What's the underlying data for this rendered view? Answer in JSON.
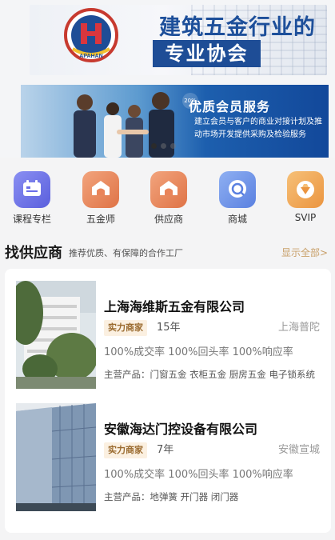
{
  "banner": {
    "top_line1": "建筑五金行业的",
    "top_line2": "专业协会",
    "logo_text": "APAHAN",
    "bottom_tag": "20%",
    "bottom_title": "优质会员服务",
    "bottom_sub": "建立会员与客户的商业对接计划及推动市场开发提供采购及检验服务"
  },
  "carousel": {
    "count": 3,
    "active": 0
  },
  "categories": [
    {
      "label": "课程专栏",
      "icon": "course-icon",
      "color": "#6a6ee8"
    },
    {
      "label": "五金师",
      "icon": "hardware-master-icon",
      "color": "#e9845a"
    },
    {
      "label": "供应商",
      "icon": "supplier-icon",
      "color": "#e9845a"
    },
    {
      "label": "商城",
      "icon": "mall-icon",
      "color": "#6a8ee6"
    },
    {
      "label": "SVIP",
      "icon": "svip-diamond-icon",
      "color": "#f0a24a"
    }
  ],
  "section": {
    "title": "找供应商",
    "subtitle": "推荐优质、有保障的合作工厂",
    "more": "显示全部>"
  },
  "suppliers": [
    {
      "name": "上海海维斯五金有限公司",
      "badge": "实力商家",
      "years": "15年",
      "location": "上海普陀",
      "rates": "100%成交率 100%回头率 100%响应率",
      "products": "主营产品：门窗五金 衣柜五金 厨房五金 电子锁系统"
    },
    {
      "name": "安徽海达门控设备有限公司",
      "badge": "实力商家",
      "years": "7年",
      "location": "安徽宣城",
      "rates": "100%成交率 100%回头率 100%响应率",
      "products": "主营产品：地弹簧 开门器 闭门器"
    }
  ],
  "colors": {
    "accent": "#c9a06a",
    "badge_bg": "#fbf0e1",
    "badge_text": "#9a6a2e",
    "banner_blue": "#1e4d96"
  }
}
